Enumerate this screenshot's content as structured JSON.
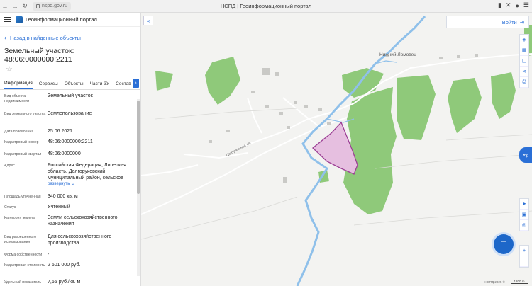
{
  "browser": {
    "url": "nspd.gov.ru",
    "tab_title": "НСПД | Геоинформационный портал"
  },
  "sidebar": {
    "portal_name": "Геоинформационный портал",
    "back_label": "Назад в найденные объекты",
    "object_title": "Земельный участок: 48:06:0000000:2211",
    "tabs": [
      "Информация",
      "Сервисы",
      "Объекты",
      "Части ЗУ",
      "Состав"
    ],
    "expand_label": "развернуть",
    "attributes": [
      {
        "label": "Вид объекта недвижимости",
        "value": "Земельный участок"
      },
      {
        "label": "Вид земельного участка",
        "value": "Землепользование"
      },
      {
        "label": "Дата присвоения",
        "value": "25.06.2021"
      },
      {
        "label": "Кадастровый номер",
        "value": "48:06:0000000:2211"
      },
      {
        "label": "Кадастровый квартал",
        "value": "48:06:0000000"
      },
      {
        "label": "Адрес",
        "value": "Российская Федерация, Липецкая область, Долгоруковский муниципальный район, сельское"
      },
      {
        "label": "Площадь уточненная",
        "value": "340 000 кв. м"
      },
      {
        "label": "Статус",
        "value": "Учтенный"
      },
      {
        "label": "Категория земель",
        "value": "Земли сельскохозяйственного назначения"
      },
      {
        "label": "Вид разрешенного использования",
        "value": "Для сельскохозяйственного производства"
      },
      {
        "label": "Форма собственности",
        "value": "-"
      },
      {
        "label": "Кадастровая стоимость",
        "value": "2 601 000 руб."
      },
      {
        "label": "Удельный показатель",
        "value": "7,65 руб./кв. м"
      }
    ]
  },
  "map": {
    "login_label": "Войти",
    "village_label": "Нижний Ломовец",
    "street_label": "Центральная ул.",
    "copyright": "НСПД 2025 ©",
    "scale_label": "1200 m"
  },
  "colors": {
    "accent": "#2a6fd6",
    "forest": "#8fc97a",
    "water": "#8fc0ea",
    "parcel_fill": "#e6bfe0",
    "parcel_stroke": "#9c3f95"
  }
}
